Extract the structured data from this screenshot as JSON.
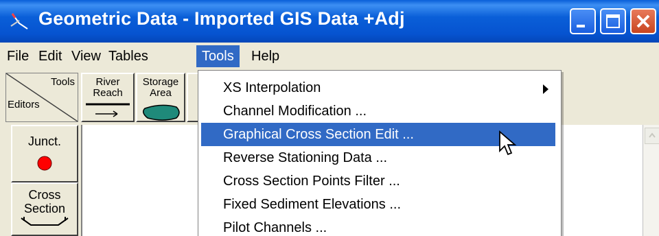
{
  "window": {
    "title": "Geometric Data - Imported GIS Data +Adj",
    "icon": "river-icon",
    "controls": [
      "minimize-icon",
      "maximize-icon",
      "close-icon"
    ]
  },
  "menubar": {
    "items": [
      {
        "label": "File"
      },
      {
        "label": "Edit"
      },
      {
        "label": "View"
      },
      {
        "label": "Tables"
      },
      {
        "label": "Tools",
        "active": true
      },
      {
        "label": "Help"
      }
    ]
  },
  "toolbar": {
    "corner_tools": "Tools",
    "corner_editors": "Editors",
    "river_reach_line1": "River",
    "river_reach_line2": "Reach",
    "storage_area_line1": "Storage",
    "storage_area_line2": "Area"
  },
  "side": {
    "junct": "Junct.",
    "cross_line1": "Cross",
    "cross_line2": "Section"
  },
  "dropdown": {
    "items": [
      {
        "label": "XS Interpolation",
        "submenu": true
      },
      {
        "label": "Channel Modification ..."
      },
      {
        "label": "Graphical Cross Section Edit ...",
        "highlighted": true
      },
      {
        "label": "Reverse Stationing Data ..."
      },
      {
        "label": "Cross Section Points Filter ..."
      },
      {
        "label": "Fixed Sediment Elevations ..."
      },
      {
        "label": "Pilot Channels ..."
      }
    ]
  },
  "colors": {
    "titlebar": "#0a5fd8",
    "highlight": "#316ac5",
    "close": "#c84520",
    "junction_dot": "#ff0000",
    "storage_fill": "#1f8a7a"
  }
}
